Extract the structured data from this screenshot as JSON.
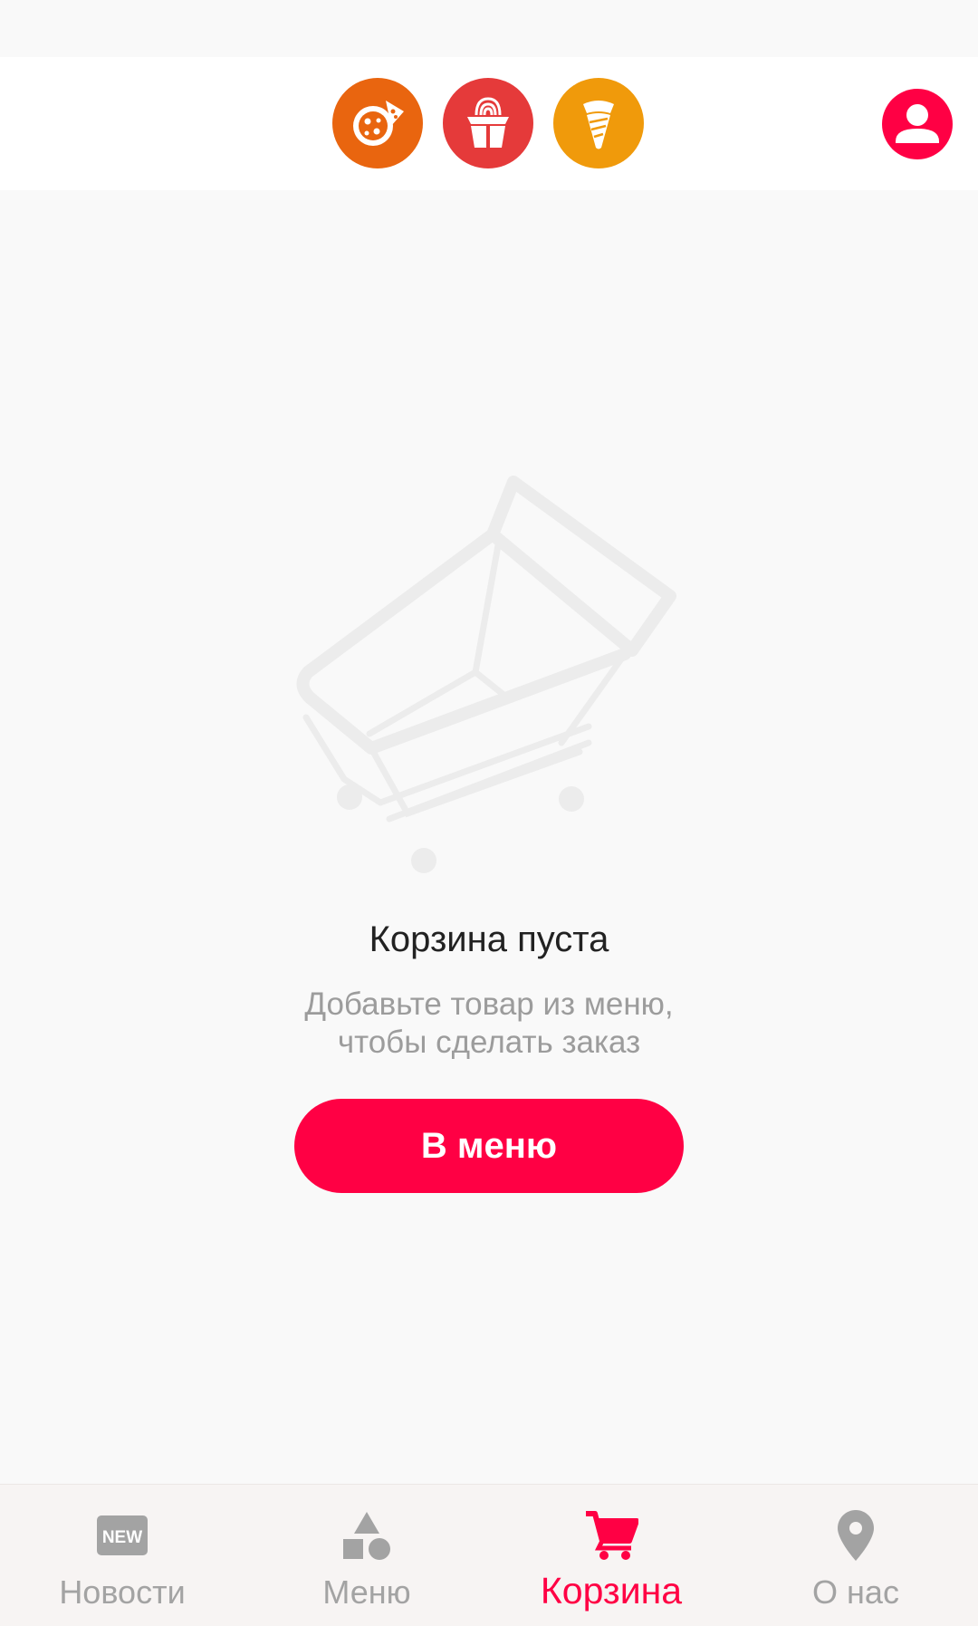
{
  "colors": {
    "accent": "#ff0044",
    "pizza": "#e9650f",
    "wok": "#e53a3a",
    "shawarma": "#f09a0b",
    "nav_inactive": "#a3a3a3"
  },
  "header": {
    "categories": [
      {
        "icon": "pizza-icon"
      },
      {
        "icon": "noodle-box-icon"
      },
      {
        "icon": "shawarma-icon"
      }
    ],
    "profile_icon": "user-profile-icon"
  },
  "cart": {
    "illustration_icon": "empty-cart-icon",
    "title": "Корзина пуста",
    "subtitle_line1": "Добавьте товар из меню,",
    "subtitle_line2": "чтобы сделать заказ",
    "button_label": "В меню"
  },
  "nav": {
    "items": [
      {
        "label": "Новости",
        "icon": "new-badge-icon",
        "active": false
      },
      {
        "label": "Меню",
        "icon": "shapes-icon",
        "active": false
      },
      {
        "label": "Корзина",
        "icon": "cart-icon",
        "active": true
      },
      {
        "label": "О нас",
        "icon": "location-pin-icon",
        "active": false
      }
    ]
  }
}
